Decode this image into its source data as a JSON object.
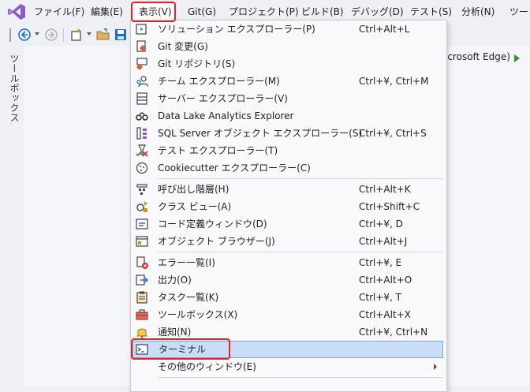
{
  "menubar": {
    "items": [
      {
        "label": "ファイル(F)"
      },
      {
        "label": "編集(E)"
      },
      {
        "label": "表示(V)"
      },
      {
        "label": "Git(G)"
      },
      {
        "label": "プロジェクト(P)"
      },
      {
        "label": "ビルド(B)"
      },
      {
        "label": "デバッグ(D)"
      },
      {
        "label": "テスト(S)"
      },
      {
        "label": "分析(N)"
      },
      {
        "label": "ツー"
      }
    ],
    "open_item": "表示(V)"
  },
  "toolbar": {
    "browser_text": "icrosoft Edge)",
    "icons": [
      "back-icon",
      "forward-icon",
      "new-item-icon",
      "open-folder-icon",
      "save-icon",
      "run-icon"
    ]
  },
  "side_panel": {
    "label": "ツールボックス"
  },
  "view_menu": {
    "items": [
      {
        "label": "ソリューション エクスプローラー(P)",
        "shortcut": "Ctrl+Alt+L",
        "icon": "solution-explorer-icon"
      },
      {
        "label": "Git 変更(G)",
        "shortcut": "",
        "icon": "git-changes-icon"
      },
      {
        "label": "Git リポジトリ(S)",
        "shortcut": "",
        "icon": "git-repository-icon"
      },
      {
        "label": "チーム エクスプローラー(M)",
        "shortcut": "Ctrl+¥, Ctrl+M",
        "icon": "team-explorer-icon"
      },
      {
        "label": "サーバー エクスプローラー(V)",
        "shortcut": "",
        "icon": "server-explorer-icon"
      },
      {
        "label": "Data Lake Analytics Explorer",
        "shortcut": "",
        "icon": "data-lake-icon"
      },
      {
        "label": "SQL Server オブジェクト エクスプローラー(S)",
        "shortcut": "Ctrl+¥, Ctrl+S",
        "icon": "sql-server-icon"
      },
      {
        "label": "テスト エクスプローラー(T)",
        "shortcut": "",
        "icon": "test-explorer-icon"
      },
      {
        "label": "Cookiecutter エクスプローラー(C)",
        "shortcut": "",
        "icon": "cookiecutter-icon"
      },
      {
        "label": "呼び出し階層(H)",
        "shortcut": "Ctrl+Alt+K",
        "icon": "call-hierarchy-icon"
      },
      {
        "label": "クラス ビュー(A)",
        "shortcut": "Ctrl+Shift+C",
        "icon": "class-view-icon"
      },
      {
        "label": "コード定義ウィンドウ(D)",
        "shortcut": "Ctrl+¥, D",
        "icon": "code-definition-icon"
      },
      {
        "label": "オブジェクト ブラウザー(J)",
        "shortcut": "Ctrl+Alt+J",
        "icon": "object-browser-icon"
      },
      {
        "label": "エラー一覧(I)",
        "shortcut": "Ctrl+¥, E",
        "icon": "error-list-icon"
      },
      {
        "label": "出力(O)",
        "shortcut": "Ctrl+Alt+O",
        "icon": "output-icon"
      },
      {
        "label": "タスク一覧(K)",
        "shortcut": "Ctrl+¥, T",
        "icon": "task-list-icon"
      },
      {
        "label": "ツールボックス(X)",
        "shortcut": "Ctrl+Alt+X",
        "icon": "toolbox-icon"
      },
      {
        "label": "通知(N)",
        "shortcut": "Ctrl+¥, Ctrl+N",
        "icon": "notification-bell-icon"
      },
      {
        "label": "ターミナル",
        "shortcut": "",
        "icon": "terminal-icon",
        "highlighted": true
      },
      {
        "label": "その他のウィンドウ(E)",
        "shortcut": "",
        "icon": "",
        "submenu": true
      }
    ]
  },
  "colors": {
    "accent_highlight": "#c9def5",
    "annotation_red": "#e0242a",
    "vs_purple": "#8b5cc8"
  }
}
